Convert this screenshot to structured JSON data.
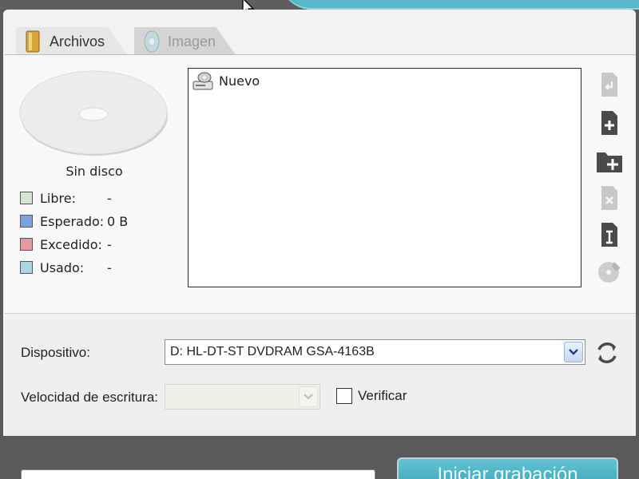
{
  "tabs": [
    {
      "label": "Archivos",
      "active": true
    },
    {
      "label": "Imagen",
      "active": false
    }
  ],
  "disc": {
    "status": "Sin disco",
    "legend": [
      {
        "label": "Libre:",
        "value": "-",
        "color": "#d6e6d8"
      },
      {
        "label": "Esperado:",
        "value": "0 B",
        "color": "#7ea3dc"
      },
      {
        "label": "Excedido:",
        "value": "-",
        "color": "#e59aa0"
      },
      {
        "label": "Usado:",
        "value": "-",
        "color": "#a8d8e2"
      }
    ]
  },
  "file_list": {
    "items": [
      {
        "label": "Nuevo",
        "icon": "disc-drive-icon"
      }
    ]
  },
  "toolbar": {
    "icons": [
      "go-up-icon",
      "add-file-icon",
      "add-folder-icon",
      "remove-file-icon",
      "rename-icon",
      "erase-disc-icon"
    ]
  },
  "device": {
    "label": "Dispositivo:",
    "value": "D: HL-DT-ST DVDRAM GSA-4163B"
  },
  "speed": {
    "label": "Velocidad de escritura:",
    "value": ""
  },
  "verify": {
    "label": "Verificar",
    "checked": false
  },
  "actions": {
    "start_label": "Iniciar grabación"
  },
  "colors": {
    "accent": "#59b8c8",
    "frame": "#5a5a5a"
  }
}
